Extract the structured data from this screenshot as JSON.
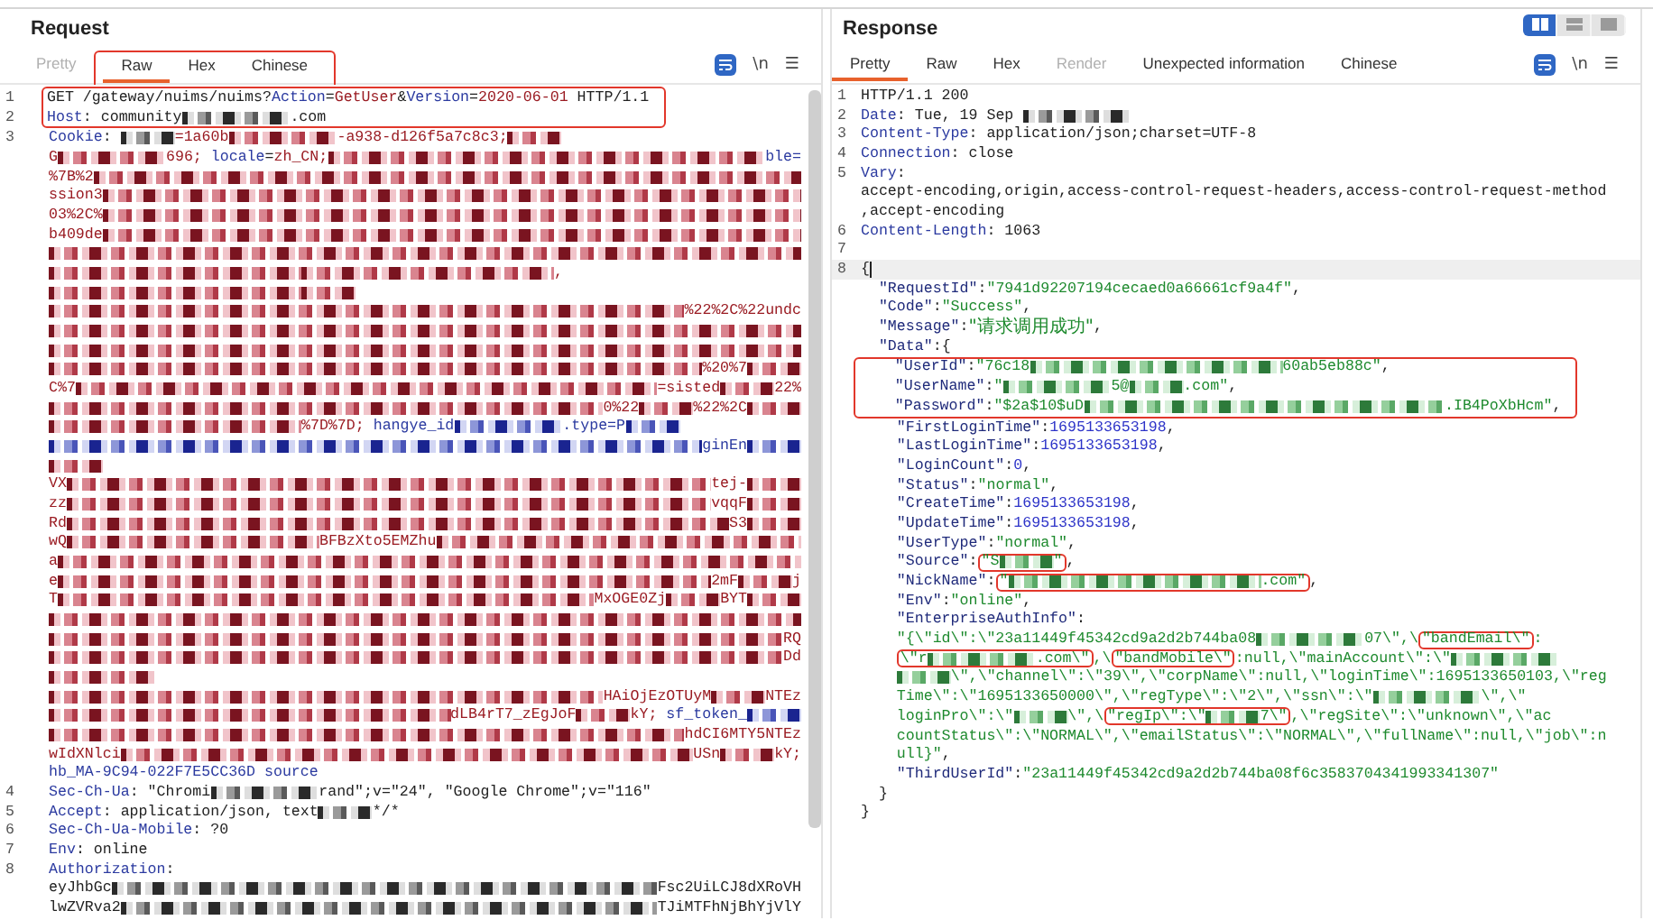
{
  "request": {
    "title": "Request",
    "tabs": [
      {
        "label": "Pretty",
        "selected": false,
        "disabled": true,
        "boxed": false
      },
      {
        "label": "Raw",
        "selected": true,
        "disabled": false,
        "boxed": true
      },
      {
        "label": "Hex",
        "selected": false,
        "disabled": false,
        "boxed": true
      },
      {
        "label": "Chinese",
        "selected": false,
        "disabled": false,
        "boxed": true
      }
    ],
    "tools": {
      "wrap_on": true,
      "newline": "\\n",
      "menu": "☰"
    },
    "lines": [
      {
        "number": "1",
        "boxed": true,
        "segments": [
          {
            "kind": "plain",
            "text": "GET /gateway/nuims/nuims?"
          },
          {
            "kind": "name",
            "text": "Action"
          },
          {
            "kind": "plain",
            "text": "="
          },
          {
            "kind": "value",
            "text": "GetUser"
          },
          {
            "kind": "plain",
            "text": "&"
          },
          {
            "kind": "name",
            "text": "Version"
          },
          {
            "kind": "plain",
            "text": "="
          },
          {
            "kind": "value",
            "text": "2020-06-01"
          },
          {
            "kind": "plain",
            "text": " HTTP/1.1"
          }
        ]
      },
      {
        "number": "2",
        "boxed": true,
        "segments": [
          {
            "kind": "name",
            "text": "Host"
          },
          {
            "kind": "plain",
            "text": ": community"
          },
          {
            "kind": "redacted-medium"
          },
          {
            "kind": "plain",
            "text": ".com"
          }
        ]
      },
      {
        "number": "3",
        "segments": [
          {
            "kind": "name",
            "text": "Cookie"
          },
          {
            "kind": "plain",
            "text": ": "
          },
          {
            "kind": "redacted-short"
          },
          {
            "kind": "value",
            "text": "=1a60b"
          },
          {
            "kind": "redacted-medium"
          },
          {
            "kind": "value",
            "text": "-a938-d126f5a7c8c3;"
          },
          {
            "kind": "redacted-short"
          }
        ]
      },
      {
        "segments": [
          {
            "kind": "value",
            "text": "G"
          },
          {
            "kind": "redacted-medium"
          },
          {
            "kind": "value",
            "text": "696;"
          },
          {
            "kind": "name",
            "text": " locale"
          },
          {
            "kind": "plain",
            "text": "="
          },
          {
            "kind": "value",
            "text": "zh_CN;"
          },
          {
            "kind": "redacted-fill"
          },
          {
            "kind": "name",
            "text": "ble="
          }
        ]
      },
      {
        "segments": [
          {
            "kind": "value",
            "text": "%7B%2"
          },
          {
            "kind": "redacted-fill"
          }
        ]
      },
      {
        "segments": [
          {
            "kind": "value",
            "text": "ssion3"
          },
          {
            "kind": "redacted-fill"
          }
        ]
      },
      {
        "segments": [
          {
            "kind": "value",
            "text": "03%2C%"
          },
          {
            "kind": "redacted-fill"
          }
        ]
      },
      {
        "segments": [
          {
            "kind": "value",
            "text": "b409de"
          },
          {
            "kind": "redacted-fill"
          }
        ]
      },
      {
        "segments": [
          {
            "kind": "redacted-fill"
          }
        ]
      },
      {
        "segments": [
          {
            "kind": "redacted-long"
          },
          {
            "kind": "redacted-long"
          },
          {
            "kind": "value",
            "text": ","
          }
        ]
      },
      {
        "segments": [
          {
            "kind": "redacted-long"
          },
          {
            "kind": "redacted-short"
          }
        ]
      },
      {
        "segments": [
          {
            "kind": "redacted-fill"
          },
          {
            "kind": "value",
            "text": "%22%2C%22undc"
          }
        ]
      },
      {
        "segments": [
          {
            "kind": "redacted-fill"
          }
        ]
      },
      {
        "segments": [
          {
            "kind": "redacted-fill"
          }
        ]
      },
      {
        "segments": [
          {
            "kind": "redacted-fill"
          },
          {
            "kind": "value",
            "text": "%20%7"
          },
          {
            "kind": "redacted-short"
          }
        ]
      },
      {
        "segments": [
          {
            "kind": "value",
            "text": "C%7"
          },
          {
            "kind": "redacted-fill"
          },
          {
            "kind": "value",
            "text": "=sisted"
          },
          {
            "kind": "redacted-short"
          },
          {
            "kind": "value",
            "text": "22%"
          }
        ]
      },
      {
        "segments": [
          {
            "kind": "redacted-fill"
          },
          {
            "kind": "value",
            "text": "0%22"
          },
          {
            "kind": "redacted-short"
          },
          {
            "kind": "value",
            "text": "%22%2C"
          },
          {
            "kind": "redacted-short"
          }
        ]
      },
      {
        "segments": [
          {
            "kind": "redacted-long"
          },
          {
            "kind": "value",
            "text": "%7D%7D;"
          },
          {
            "kind": "name",
            "text": " hangye_id"
          },
          {
            "kind": "redacted-medium"
          },
          {
            "kind": "name",
            "text": ".type=P"
          },
          {
            "kind": "redacted-short"
          }
        ]
      },
      {
        "segments": [
          {
            "kind": "redacted-fill"
          },
          {
            "kind": "name",
            "text": "ginEn"
          },
          {
            "kind": "redacted-short"
          }
        ]
      },
      {
        "segments": [
          {
            "kind": "redacted-short"
          }
        ]
      },
      {
        "segments": [
          {
            "kind": "value",
            "text": "VX"
          },
          {
            "kind": "redacted-fill"
          },
          {
            "kind": "value",
            "text": "tej-"
          },
          {
            "kind": "redacted-short"
          }
        ]
      },
      {
        "segments": [
          {
            "kind": "value",
            "text": "zz"
          },
          {
            "kind": "redacted-fill"
          },
          {
            "kind": "value",
            "text": "vqqF"
          },
          {
            "kind": "redacted-short"
          }
        ]
      },
      {
        "segments": [
          {
            "kind": "value",
            "text": "Rd"
          },
          {
            "kind": "redacted-fill"
          },
          {
            "kind": "value",
            "text": "S3"
          },
          {
            "kind": "redacted-short"
          }
        ]
      },
      {
        "segments": [
          {
            "kind": "value",
            "text": "wQ"
          },
          {
            "kind": "redacted-long"
          },
          {
            "kind": "value",
            "text": "BFBzXto5EMZhu"
          },
          {
            "kind": "redacted-fill"
          }
        ]
      },
      {
        "segments": [
          {
            "kind": "value",
            "text": "a"
          },
          {
            "kind": "redacted-fill"
          }
        ]
      },
      {
        "segments": [
          {
            "kind": "value",
            "text": "e"
          },
          {
            "kind": "redacted-fill"
          },
          {
            "kind": "value",
            "text": "2mF"
          },
          {
            "kind": "redacted-short"
          },
          {
            "kind": "value",
            "text": "j"
          }
        ]
      },
      {
        "segments": [
          {
            "kind": "value",
            "text": "T"
          },
          {
            "kind": "redacted-fill"
          },
          {
            "kind": "value",
            "text": "MxOGE0Zj"
          },
          {
            "kind": "redacted-short"
          },
          {
            "kind": "value",
            "text": "BYT"
          },
          {
            "kind": "redacted-short"
          }
        ]
      },
      {
        "segments": [
          {
            "kind": "redacted-fill"
          }
        ]
      },
      {
        "segments": [
          {
            "kind": "redacted-fill"
          },
          {
            "kind": "value",
            "text": "RQ"
          }
        ]
      },
      {
        "segments": [
          {
            "kind": "redacted-fill"
          },
          {
            "kind": "value",
            "text": "Dd"
          }
        ]
      },
      {
        "segments": [
          {
            "kind": "redacted-medium"
          }
        ]
      },
      {
        "segments": [
          {
            "kind": "redacted-fill"
          },
          {
            "kind": "value",
            "text": "HAiOjEzOTUyM"
          },
          {
            "kind": "redacted-short"
          },
          {
            "kind": "value",
            "text": "NTEz"
          }
        ]
      },
      {
        "segments": [
          {
            "kind": "redacted-fill"
          },
          {
            "kind": "value",
            "text": "dLB4rT7_zEgJoF"
          },
          {
            "kind": "redacted-short"
          },
          {
            "kind": "value",
            "text": "kY;"
          },
          {
            "kind": "name",
            "text": " sf_token_"
          },
          {
            "kind": "redacted-short"
          }
        ]
      },
      {
        "segments": [
          {
            "kind": "redacted-fill"
          },
          {
            "kind": "value",
            "text": "hdCI6MTY5NTEz"
          }
        ]
      },
      {
        "segments": [
          {
            "kind": "value",
            "text": "wIdXNlci"
          },
          {
            "kind": "redacted-fill"
          },
          {
            "kind": "value",
            "text": "USn"
          },
          {
            "kind": "redacted-short"
          },
          {
            "kind": "value",
            "text": "kY;"
          }
        ]
      },
      {
        "segments": [
          {
            "kind": "name",
            "text": "hb_MA-9C94-022F7E5CC36D source"
          }
        ]
      },
      {
        "number": "4",
        "segments": [
          {
            "kind": "name",
            "text": "Sec-Ch-Ua"
          },
          {
            "kind": "plain",
            "text": ": \"Chromi"
          },
          {
            "kind": "redacted-medium"
          },
          {
            "kind": "plain",
            "text": "rand\";v=\"24\", \"Google Chrome\";v=\"116\""
          }
        ]
      },
      {
        "number": "5",
        "segments": [
          {
            "kind": "name",
            "text": "Accept"
          },
          {
            "kind": "plain",
            "text": ": application/json, text"
          },
          {
            "kind": "redacted-short"
          },
          {
            "kind": "plain",
            "text": "*/*"
          }
        ]
      },
      {
        "number": "6",
        "segments": [
          {
            "kind": "name",
            "text": "Sec-Ch-Ua-Mobile"
          },
          {
            "kind": "plain",
            "text": ": ?0"
          }
        ]
      },
      {
        "number": "7",
        "segments": [
          {
            "kind": "name",
            "text": "Env"
          },
          {
            "kind": "plain",
            "text": ": online"
          }
        ]
      },
      {
        "number": "8",
        "segments": [
          {
            "kind": "name",
            "text": "Authorization"
          },
          {
            "kind": "plain",
            "text": ":"
          }
        ]
      },
      {
        "segments": [
          {
            "kind": "plain",
            "text": "eyJhbGc"
          },
          {
            "kind": "redacted-fill"
          },
          {
            "kind": "plain",
            "text": "Fsc2UiLCJ8dXRoVH"
          }
        ]
      },
      {
        "segments": [
          {
            "kind": "plain",
            "text": "lwZVRva2"
          },
          {
            "kind": "redacted-fill"
          },
          {
            "kind": "plain",
            "text": "TJiMTFhNjBhYjVlY"
          }
        ]
      }
    ]
  },
  "response": {
    "title": "Response",
    "layout_toggles": [
      {
        "kind": "columns",
        "selected": true
      },
      {
        "kind": "rows",
        "selected": false
      },
      {
        "kind": "single",
        "selected": false
      }
    ],
    "tabs": [
      {
        "label": "Pretty",
        "selected": true,
        "disabled": false,
        "boxed": false
      },
      {
        "label": "Raw",
        "selected": false,
        "disabled": false,
        "boxed": false
      },
      {
        "label": "Hex",
        "selected": false,
        "disabled": false,
        "boxed": false
      },
      {
        "label": "Render",
        "selected": false,
        "disabled": true,
        "boxed": false
      },
      {
        "label": "Unexpected information",
        "selected": false,
        "disabled": false,
        "boxed": false
      },
      {
        "label": "Chinese",
        "selected": false,
        "disabled": false,
        "boxed": false
      }
    ],
    "tools": {
      "wrap_on": true,
      "newline": "\\n",
      "menu": "☰"
    },
    "lines": [
      {
        "number": "1",
        "segments": [
          {
            "kind": "plain",
            "text": "HTTP/1.1 200"
          }
        ]
      },
      {
        "number": "2",
        "segments": [
          {
            "kind": "name",
            "text": "Date"
          },
          {
            "kind": "plain",
            "text": ": Tue, 19 Sep "
          },
          {
            "kind": "redacted-medium"
          }
        ]
      },
      {
        "number": "3",
        "segments": [
          {
            "kind": "name",
            "text": "Content-Type"
          },
          {
            "kind": "plain",
            "text": ": application/json;charset=UTF-8"
          }
        ]
      },
      {
        "number": "4",
        "segments": [
          {
            "kind": "name",
            "text": "Connection"
          },
          {
            "kind": "plain",
            "text": ": close"
          }
        ]
      },
      {
        "number": "5",
        "segments": [
          {
            "kind": "name",
            "text": "Vary"
          },
          {
            "kind": "plain",
            "text": ":"
          }
        ]
      },
      {
        "segments": [
          {
            "kind": "plain",
            "text": "accept-encoding,origin,access-control-request-headers,access-control-request-method"
          }
        ]
      },
      {
        "segments": [
          {
            "kind": "plain",
            "text": ",accept-encoding"
          }
        ]
      },
      {
        "number": "6",
        "segments": [
          {
            "kind": "name",
            "text": "Content-Length"
          },
          {
            "kind": "plain",
            "text": ": 1063"
          }
        ]
      },
      {
        "number": "7"
      },
      {
        "number": "8",
        "current": true,
        "segments": [
          {
            "kind": "plain",
            "text": "{"
          }
        ]
      },
      {
        "segments": [
          {
            "kind": "key",
            "text": "  \"RequestId\""
          },
          {
            "kind": "plain",
            "text": ":"
          },
          {
            "kind": "string",
            "text": "\"7941d92207194cecaed0a66661cf9a4f\""
          },
          {
            "kind": "plain",
            "text": ","
          }
        ]
      },
      {
        "segments": [
          {
            "kind": "key",
            "text": "  \"Code\""
          },
          {
            "kind": "plain",
            "text": ":"
          },
          {
            "kind": "string",
            "text": "\"Success\""
          },
          {
            "kind": "plain",
            "text": ","
          }
        ]
      },
      {
        "segments": [
          {
            "kind": "key",
            "text": "  \"Message\""
          },
          {
            "kind": "plain",
            "text": ":"
          },
          {
            "kind": "string-cjk",
            "text": "\"请求调用成功\""
          },
          {
            "kind": "plain",
            "text": ","
          }
        ]
      },
      {
        "segments": [
          {
            "kind": "key",
            "text": "  \"Data\""
          },
          {
            "kind": "plain",
            "text": ":{"
          }
        ]
      },
      {
        "boxed": true,
        "segments": [
          {
            "kind": "key",
            "text": "    \"UserId\""
          },
          {
            "kind": "plain",
            "text": ":"
          },
          {
            "kind": "string",
            "text": "\"76c18"
          },
          {
            "kind": "redacted-long"
          },
          {
            "kind": "string",
            "text": "60ab5eb88c\""
          },
          {
            "kind": "plain",
            "text": ","
          }
        ]
      },
      {
        "boxed": true,
        "segments": [
          {
            "kind": "key",
            "text": "    \"UserName\""
          },
          {
            "kind": "plain",
            "text": ":"
          },
          {
            "kind": "string",
            "text": "\""
          },
          {
            "kind": "redacted-medium"
          },
          {
            "kind": "string",
            "text": "5@"
          },
          {
            "kind": "redacted-short"
          },
          {
            "kind": "string",
            "text": ".com\""
          },
          {
            "kind": "plain",
            "text": ","
          }
        ]
      },
      {
        "boxed": true,
        "segments": [
          {
            "kind": "key",
            "text": "    \"Password\""
          },
          {
            "kind": "plain",
            "text": ":"
          },
          {
            "kind": "string",
            "text": "\"$2a$10$uD"
          },
          {
            "kind": "redacted-xlong"
          },
          {
            "kind": "string",
            "text": ".IB4PoXbHcm\""
          },
          {
            "kind": "plain",
            "text": ","
          }
        ]
      },
      {
        "segments": [
          {
            "kind": "key",
            "text": "    \"FirstLoginTime\""
          },
          {
            "kind": "plain",
            "text": ":"
          },
          {
            "kind": "number",
            "text": "1695133653198"
          },
          {
            "kind": "plain",
            "text": ","
          }
        ]
      },
      {
        "segments": [
          {
            "kind": "key",
            "text": "    \"LastLoginTime\""
          },
          {
            "kind": "plain",
            "text": ":"
          },
          {
            "kind": "number",
            "text": "1695133653198"
          },
          {
            "kind": "plain",
            "text": ","
          }
        ]
      },
      {
        "segments": [
          {
            "kind": "key",
            "text": "    \"LoginCount\""
          },
          {
            "kind": "plain",
            "text": ":"
          },
          {
            "kind": "number",
            "text": "0"
          },
          {
            "kind": "plain",
            "text": ","
          }
        ]
      },
      {
        "segments": [
          {
            "kind": "key",
            "text": "    \"Status\""
          },
          {
            "kind": "plain",
            "text": ":"
          },
          {
            "kind": "string",
            "text": "\"normal\""
          },
          {
            "kind": "plain",
            "text": ","
          }
        ]
      },
      {
        "segments": [
          {
            "kind": "key",
            "text": "    \"CreateTime\""
          },
          {
            "kind": "plain",
            "text": ":"
          },
          {
            "kind": "number",
            "text": "1695133653198"
          },
          {
            "kind": "plain",
            "text": ","
          }
        ]
      },
      {
        "segments": [
          {
            "kind": "key",
            "text": "    \"UpdateTime\""
          },
          {
            "kind": "plain",
            "text": ":"
          },
          {
            "kind": "number",
            "text": "1695133653198"
          },
          {
            "kind": "plain",
            "text": ","
          }
        ]
      },
      {
        "segments": [
          {
            "kind": "key",
            "text": "    \"UserType\""
          },
          {
            "kind": "plain",
            "text": ":"
          },
          {
            "kind": "string",
            "text": "\"normal\""
          },
          {
            "kind": "plain",
            "text": ","
          }
        ]
      },
      {
        "segments": [
          {
            "kind": "key",
            "text": "    \"Source\""
          },
          {
            "kind": "plain",
            "text": ":"
          },
          {
            "kind": "string",
            "text": "\"S",
            "boxed": true
          },
          {
            "kind": "redacted-short",
            "boxed": true
          },
          {
            "kind": "string",
            "text": "\"",
            "boxed": true
          },
          {
            "kind": "plain",
            "text": ","
          }
        ]
      },
      {
        "segments": [
          {
            "kind": "key",
            "text": "    \"NickName\""
          },
          {
            "kind": "plain",
            "text": ":"
          },
          {
            "kind": "string",
            "text": "\"",
            "boxed": true
          },
          {
            "kind": "redacted-long",
            "boxed": true
          },
          {
            "kind": "string",
            "text": ".com\"",
            "boxed": true
          },
          {
            "kind": "plain",
            "text": ","
          }
        ]
      },
      {
        "segments": [
          {
            "kind": "key",
            "text": "    \"Env\""
          },
          {
            "kind": "plain",
            "text": ":"
          },
          {
            "kind": "string",
            "text": "\"online\""
          },
          {
            "kind": "plain",
            "text": ","
          }
        ]
      },
      {
        "segments": [
          {
            "kind": "key",
            "text": "    \"EnterpriseAuthInfo\""
          },
          {
            "kind": "plain",
            "text": ":"
          }
        ]
      },
      {
        "segments": [
          {
            "kind": "string",
            "text": "    \"{\\\"id\\\":\\\"23a11449f45342cd9a2d2b744ba08"
          },
          {
            "kind": "redacted-medium"
          },
          {
            "kind": "string",
            "text": "07\\\",\\"
          },
          {
            "kind": "string",
            "text": "\"bandEmail\\\"",
            "boxed": true
          },
          {
            "kind": "string",
            "text": ":"
          }
        ]
      },
      {
        "continuation": true,
        "segments": [
          {
            "kind": "string",
            "text": "\\\"r",
            "boxed": true
          },
          {
            "kind": "redacted-medium",
            "boxed": true
          },
          {
            "kind": "string",
            "text": ".com\\\"",
            "boxed": true
          },
          {
            "kind": "string",
            "text": ",\\"
          },
          {
            "kind": "string",
            "text": "\"bandMobile\\\"",
            "boxed": true
          },
          {
            "kind": "string",
            "text": ":null,\\\"mainAccount\\\":\\\""
          },
          {
            "kind": "redacted-medium"
          }
        ]
      },
      {
        "continuation": true,
        "segments": [
          {
            "kind": "redacted-short"
          },
          {
            "kind": "string",
            "text": "\\\",\\\"channel\\\":\\\"39\\\",\\\"corpName\\\":null,\\\"loginTime\\\":1695133650103,\\\"reg"
          }
        ]
      },
      {
        "continuation": true,
        "segments": [
          {
            "kind": "string",
            "text": "Time\\\":\\\"1695133650000\\\",\\\"regType\\\":\\\"2\\\",\\\"ssn\\\":\\\""
          },
          {
            "kind": "redacted-medium"
          },
          {
            "kind": "string",
            "text": "\\\",\\\""
          }
        ]
      },
      {
        "continuation": true,
        "segments": [
          {
            "kind": "string",
            "text": "loginPro\\\":\\\""
          },
          {
            "kind": "redacted-short"
          },
          {
            "kind": "string",
            "text": "\\\",\\"
          },
          {
            "kind": "string",
            "text": "\"regIp\\\":\\\"",
            "boxed": true
          },
          {
            "kind": "redacted-short",
            "boxed": true
          },
          {
            "kind": "string",
            "text": "7\\\"",
            "boxed": true
          },
          {
            "kind": "string",
            "text": ",\\\"regSite\\\":\\\"unknown\\\",\\\"ac"
          }
        ]
      },
      {
        "continuation": true,
        "segments": [
          {
            "kind": "string",
            "text": "countStatus\\\":\\\"NORMAL\\\",\\\"emailStatus\\\":\\\"NORMAL\\\",\\\"fullName\\\":null,\\\"job\\\":n"
          }
        ]
      },
      {
        "continuation": true,
        "segments": [
          {
            "kind": "string",
            "text": "ull}\""
          },
          {
            "kind": "plain",
            "text": ","
          }
        ]
      },
      {
        "segments": [
          {
            "kind": "key",
            "text": "    \"ThirdUserId\""
          },
          {
            "kind": "plain",
            "text": ":"
          },
          {
            "kind": "string",
            "text": "\"23a11449f45342cd9a2d2b744ba08f6c3583704341993341307\""
          }
        ]
      },
      {
        "segments": [
          {
            "kind": "plain",
            "text": "  }"
          }
        ]
      },
      {
        "segments": [
          {
            "kind": "plain",
            "text": "}"
          }
        ]
      }
    ]
  }
}
